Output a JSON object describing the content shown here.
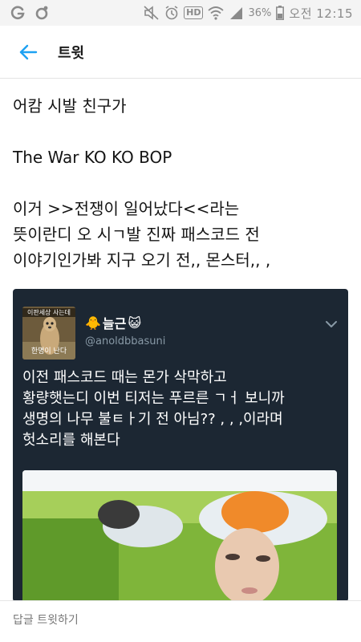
{
  "status_bar": {
    "battery_pct": "36%",
    "time": "오전 12:15",
    "hd_label": "HD",
    "left_icons": [
      "g-icon",
      "sync-icon"
    ],
    "right_icons": [
      "mute-icon",
      "alarm-icon",
      "hd-icon",
      "wifi-icon",
      "signal-icon",
      "battery-icon"
    ]
  },
  "app_bar": {
    "title": "트윗",
    "back_icon": "arrow-left-icon",
    "accent": "#1da1f2"
  },
  "tweet": {
    "lines": [
      "어캄 시발 친구가",
      "The War KO KO BOP",
      "이거 >>전쟁이 일어났다<<라는",
      "뜻이란디 오 시ㄱ발 진짜 패스코드 전",
      "이야기인가봐 지구 오기 전,, 몬스터,, ,"
    ]
  },
  "quoted_tweet": {
    "avatar_top_text": "이판세상 사는데",
    "avatar_bottom_text": "한명이 난다",
    "display_name": "늘근",
    "name_prefix_emoji": "🐥",
    "name_suffix_emoji": "😺",
    "handle": "@anoldbbasuni",
    "text_lines": [
      "이전 패스코드 때는 몬가 삭막하고",
      "황량햇는디 이번 티저는 푸르른 ㄱㅓ 보니까",
      "생명의 나무 불ㅌㅏ기 전 아님?? , , ,이라며",
      "헛소리를 해본다"
    ],
    "card_bg": "#1c2733",
    "handle_color": "#8899a6"
  },
  "reply": {
    "placeholder": "답글 트윗하기"
  }
}
